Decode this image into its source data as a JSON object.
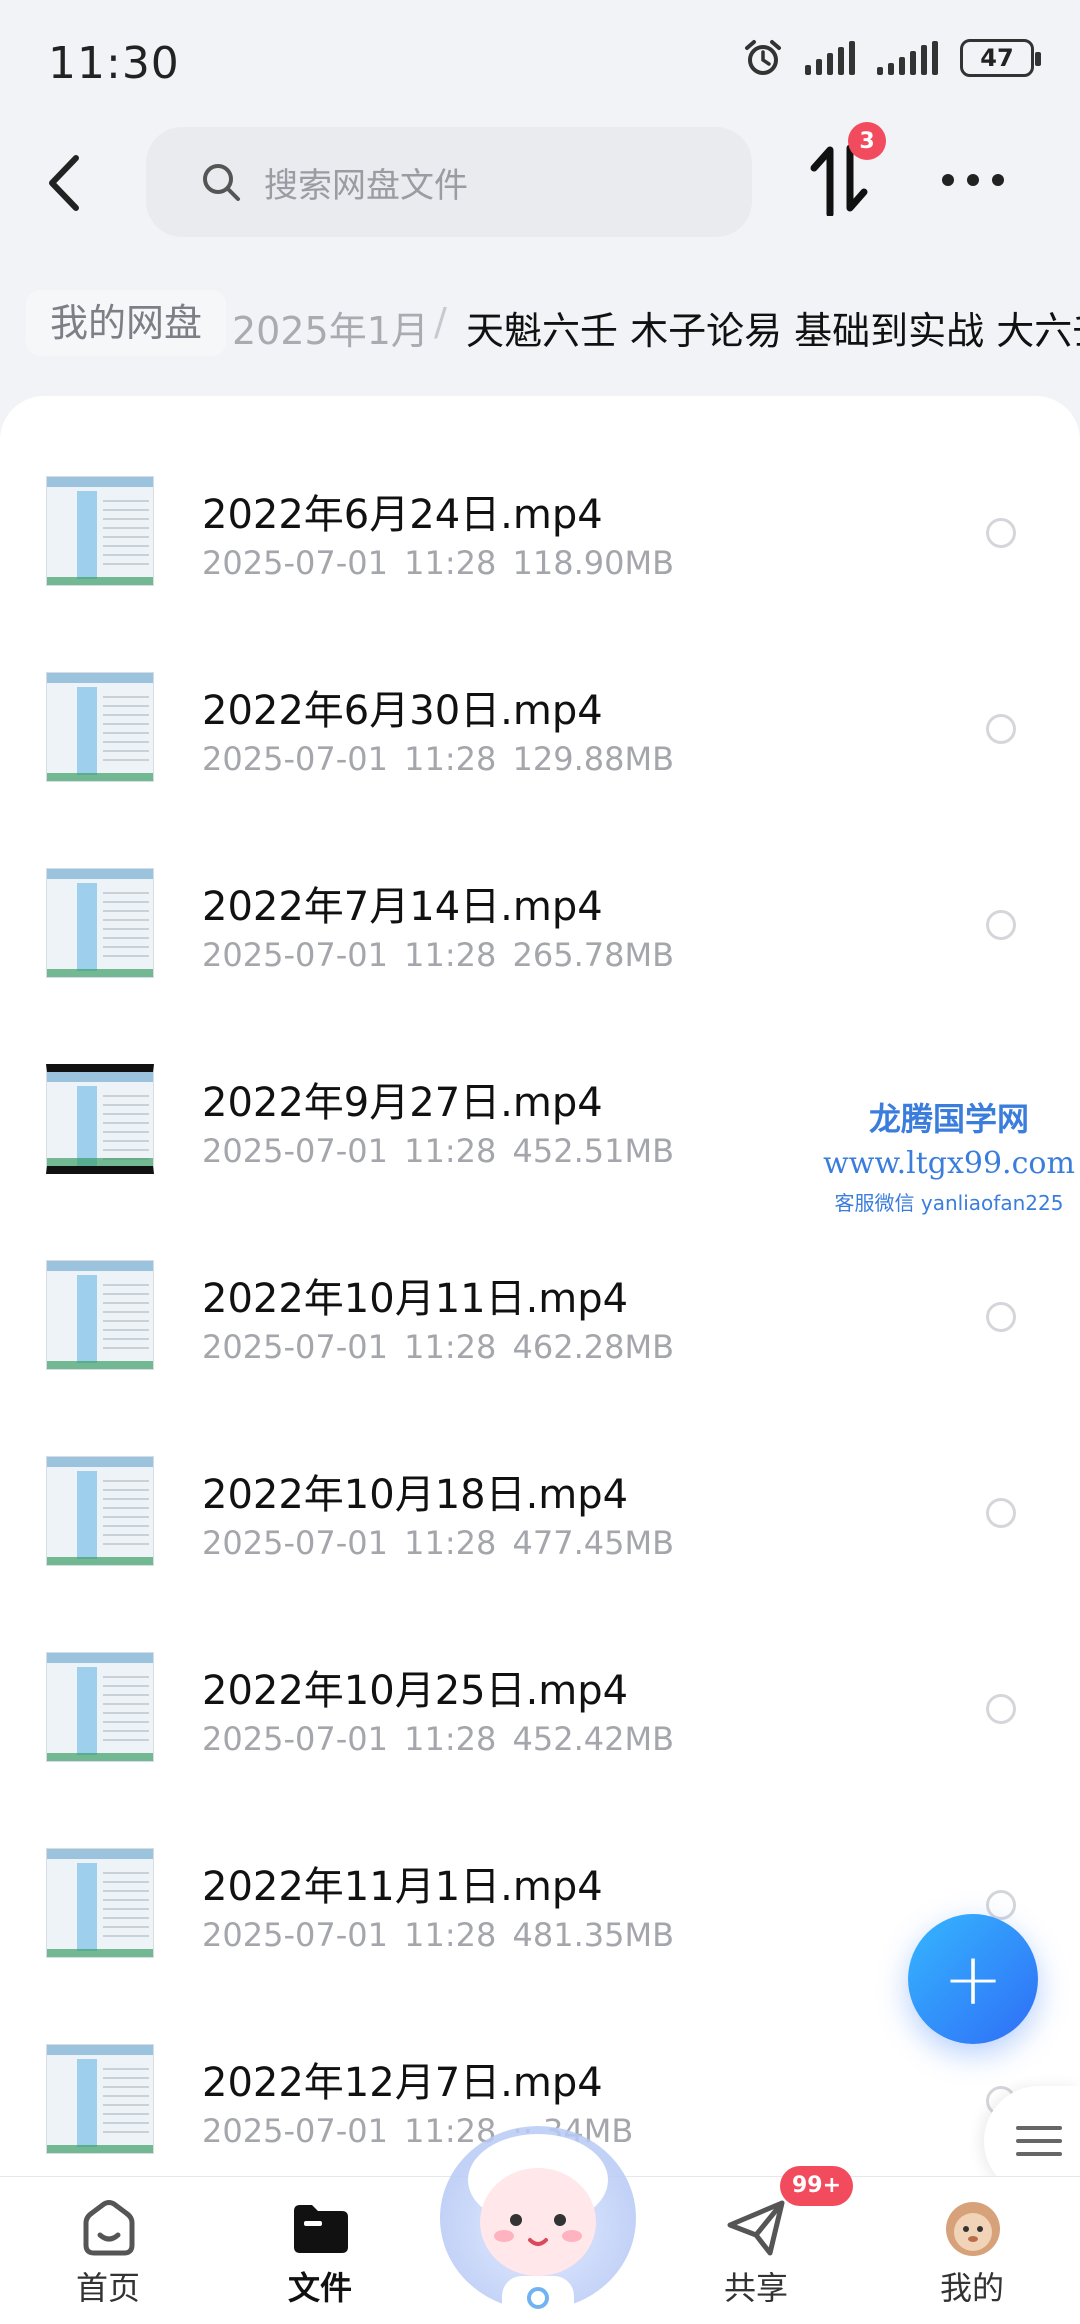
{
  "status_bar": {
    "time": "11:30",
    "battery": "47"
  },
  "header": {
    "search_placeholder": "搜索网盘文件",
    "transfer_badge": "3"
  },
  "breadcrumb": {
    "root": "我的网盘",
    "year": "2025年1月",
    "separator": "/",
    "folder": "天魁六壬  木子论易  基础到实战  大六壬"
  },
  "files": [
    {
      "name": "2022年6月24日.mp4",
      "date": "2025-07-01",
      "time": "11:28",
      "size": "118.90MB"
    },
    {
      "name": "2022年6月30日.mp4",
      "date": "2025-07-01",
      "time": "11:28",
      "size": "129.88MB"
    },
    {
      "name": "2022年7月14日.mp4",
      "date": "2025-07-01",
      "time": "11:28",
      "size": "265.78MB"
    },
    {
      "name": "2022年9月27日.mp4",
      "date": "2025-07-01",
      "time": "11:28",
      "size": "452.51MB"
    },
    {
      "name": "2022年10月11日.mp4",
      "date": "2025-07-01",
      "time": "11:28",
      "size": "462.28MB"
    },
    {
      "name": "2022年10月18日.mp4",
      "date": "2025-07-01",
      "time": "11:28",
      "size": "477.45MB"
    },
    {
      "name": "2022年10月25日.mp4",
      "date": "2025-07-01",
      "time": "11:28",
      "size": "452.42MB"
    },
    {
      "name": "2022年11月1日.mp4",
      "date": "2025-07-01",
      "time": "11:28",
      "size": "481.35MB"
    },
    {
      "name": "2022年12月7日.mp4",
      "date": "2025-07-01",
      "time": "11:28",
      "size": "··.34MB"
    }
  ],
  "watermark": {
    "line1": "龙腾国学网",
    "line2": "www.ltgx99.com",
    "line3": "客服微信 yanliaofan225"
  },
  "fab": {
    "label": "+"
  },
  "bottom_nav": {
    "home": "首页",
    "files": "文件",
    "share": "共享",
    "share_badge": "99+",
    "me": "我的"
  },
  "colors": {
    "accent": "#2f6df6",
    "badge": "#f24b5d"
  }
}
